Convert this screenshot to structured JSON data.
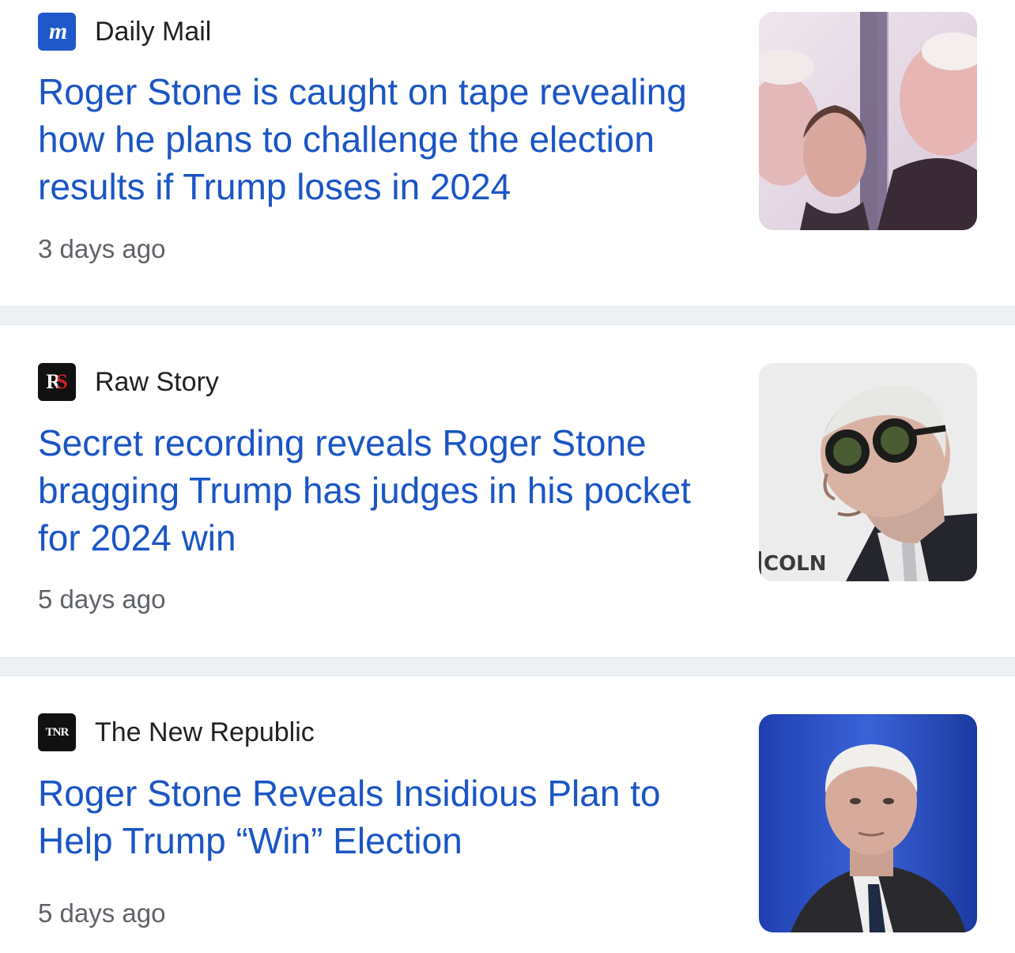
{
  "articles": [
    {
      "source": "Daily Mail",
      "logo_text": "m",
      "headline": "Roger Stone is caught on tape revealing how he plans to challenge the election results if Trump loses in 2024",
      "time": "3 days ago"
    },
    {
      "source": "Raw Story",
      "logo_text": "R",
      "logo_text_accent": "S",
      "headline": "Secret recording reveals Roger Stone bragging Trump has judges in his pocket for 2024 win",
      "time": "5 days ago",
      "image_text": "COLN"
    },
    {
      "source": "The New Republic",
      "logo_text": "TNR",
      "headline": "Roger Stone Reveals Insidious Plan to Help Trump “Win” Election",
      "time": "5 days ago"
    }
  ],
  "colors": {
    "headline": "#1a55c5",
    "source": "#202124",
    "time": "#5f6368",
    "divider": "#eef1f4",
    "daily_mail_logo": "#1f58c8"
  }
}
